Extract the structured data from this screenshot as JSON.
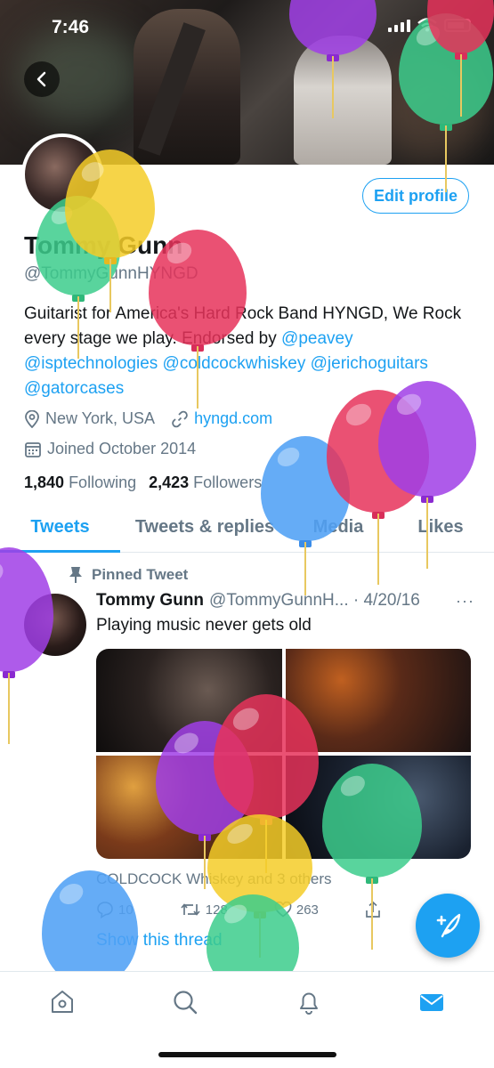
{
  "status_bar": {
    "time": "7:46"
  },
  "profile": {
    "name": "Tommy Gunn",
    "handle": "@TommyGunnHYNGD",
    "edit_label": "Edit profile",
    "bio_text": "Guitarist for America's Hard Rock Band HYNGD, We Rock every stage we play. Endorsed by ",
    "bio_links": [
      "@peavey",
      "@isptechnologies",
      "@coldcockwhiskey",
      "@jerichoguitars",
      "@gatorcases"
    ],
    "location": "New York, USA",
    "website": "hyngd.com",
    "joined": "Joined October 2014",
    "following_count": "1,840",
    "following_label": "Following",
    "followers_count": "2,423",
    "followers_label": "Followers"
  },
  "tabs": [
    {
      "label": "Tweets",
      "active": true
    },
    {
      "label": "Tweets & replies",
      "active": false
    },
    {
      "label": "Media",
      "active": false
    },
    {
      "label": "Likes",
      "active": false
    }
  ],
  "tweet": {
    "pinned_label": "Pinned Tweet",
    "author_name": "Tommy Gunn",
    "author_meta": "@TommyGunnH... · 4/20/16",
    "more": "···",
    "text": "Playing music never gets old",
    "liked_by": "COLDCOCK Whiskey and 3 others",
    "reply_count": "10",
    "retweet_count": "128",
    "like_count": "263",
    "show_thread": "Show this thread"
  },
  "colors": {
    "accent": "#1da1f2",
    "text_primary": "#14171a",
    "text_secondary": "#657786",
    "divider": "#e1e8ed"
  },
  "icons": {
    "back": "chevron-left-icon",
    "location": "map-pin-icon",
    "link": "link-icon",
    "calendar": "calendar-icon",
    "pin": "pin-icon",
    "reply": "reply-icon",
    "retweet": "retweet-icon",
    "like": "heart-icon",
    "share": "share-icon",
    "compose": "compose-feather-icon",
    "nav": [
      "home-icon",
      "search-icon",
      "bell-icon",
      "mail-icon"
    ]
  },
  "decorations": {
    "balloon_colors": [
      "purple",
      "green",
      "yellow",
      "red",
      "blue"
    ]
  }
}
